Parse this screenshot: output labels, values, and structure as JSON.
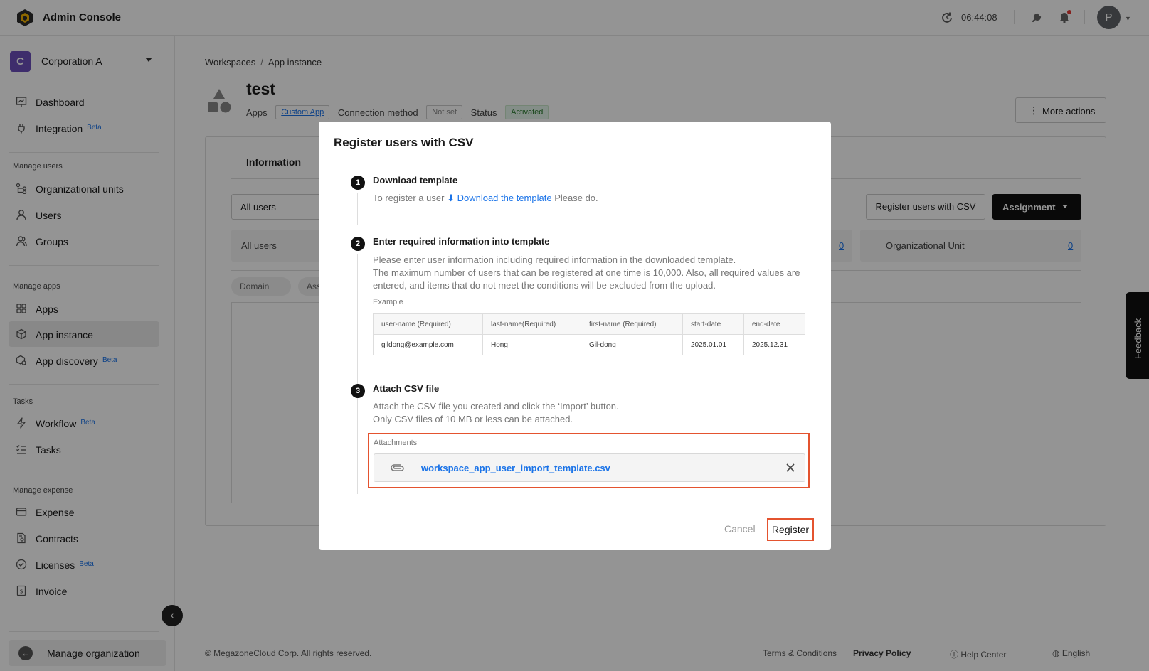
{
  "header": {
    "app_title": "Admin Console",
    "clock": "06:44:08",
    "avatar_initial": "P"
  },
  "sidebar": {
    "corp_badge": "C",
    "corp_name": "Corporation A",
    "items_top": [
      {
        "label": "Dashboard",
        "icon": "dashboard-icon"
      },
      {
        "label": "Integration",
        "icon": "integration-icon",
        "beta": "Beta"
      }
    ],
    "section_users": "Manage users",
    "items_users": [
      {
        "label": "Organizational units",
        "icon": "org-units-icon"
      },
      {
        "label": "Users",
        "icon": "user-icon"
      },
      {
        "label": "Groups",
        "icon": "groups-icon"
      }
    ],
    "section_apps": "Manage apps",
    "items_apps": [
      {
        "label": "Apps",
        "icon": "apps-grid-icon"
      },
      {
        "label": "App instance",
        "icon": "app-instance-icon",
        "active": true
      },
      {
        "label": "App discovery",
        "icon": "app-discovery-icon",
        "beta": "Beta"
      }
    ],
    "section_tasks": "Tasks",
    "items_tasks": [
      {
        "label": "Workflow",
        "icon": "workflow-icon",
        "beta": "Beta"
      },
      {
        "label": "Tasks",
        "icon": "tasks-icon"
      }
    ],
    "section_expense": "Manage expense",
    "items_expense": [
      {
        "label": "Expense",
        "icon": "expense-icon"
      },
      {
        "label": "Contracts",
        "icon": "contracts-icon"
      },
      {
        "label": "Licenses",
        "icon": "licenses-icon",
        "beta": "Beta"
      },
      {
        "label": "Invoice",
        "icon": "invoice-icon"
      }
    ],
    "manage_org": "Manage organization"
  },
  "main": {
    "breadcrumb": [
      "Workspaces",
      "App instance"
    ],
    "title": "test",
    "meta": {
      "apps_label": "Apps",
      "apps_value": "Custom App",
      "connection_label": "Connection method",
      "connection_value": "Not set",
      "status_label": "Status",
      "status_value": "Activated"
    },
    "more_actions": "More actions",
    "tab_information": "Information",
    "user_filter": "All users",
    "register_csv_button": "Register users with CSV",
    "assignment_button": "Assignment",
    "stats": {
      "all_users_label": "All users",
      "hidden_count": "0",
      "org_unit_label": "Organizational Unit",
      "org_unit_count": "0"
    },
    "filter_domain": "Domain",
    "filter_assigned": "Ass"
  },
  "footer": {
    "copyright": "© MegazoneCloud Corp. All rights reserved.",
    "terms": "Terms & Conditions",
    "privacy": "Privacy Policy",
    "help": "Help Center",
    "language": "English"
  },
  "feedback_label": "Feedback",
  "modal": {
    "title": "Register users with CSV",
    "step1": {
      "num": "1",
      "title": "Download template",
      "prefix": "To register a user",
      "link": "Download the template",
      "suffix": "Please do."
    },
    "step2": {
      "num": "2",
      "title": "Enter required information into template",
      "line1": "Please enter user information including required information in the downloaded template.",
      "line2": "The maximum number of users that can be registered at one time is 10,000. Also, all required values are entered, and items that do not meet the conditions will be excluded from the upload.",
      "example_label": "Example",
      "table_headers": [
        "user-name (Required)",
        "last-name(Required)",
        "first-name (Required)",
        "start-date",
        "end-date"
      ],
      "table_row": [
        "gildong@example.com",
        "Hong",
        "Gil-dong",
        "2025.01.01",
        "2025.12.31"
      ]
    },
    "step3": {
      "num": "3",
      "title": "Attach CSV file",
      "line1": "Attach the CSV file you created and click the ‘Import’ button.",
      "line2": "Only CSV files of 10 MB or less can be attached.",
      "attachments_label": "Attachments",
      "file_name": "workspace_app_user_import_template.csv"
    },
    "cancel": "Cancel",
    "register": "Register"
  }
}
